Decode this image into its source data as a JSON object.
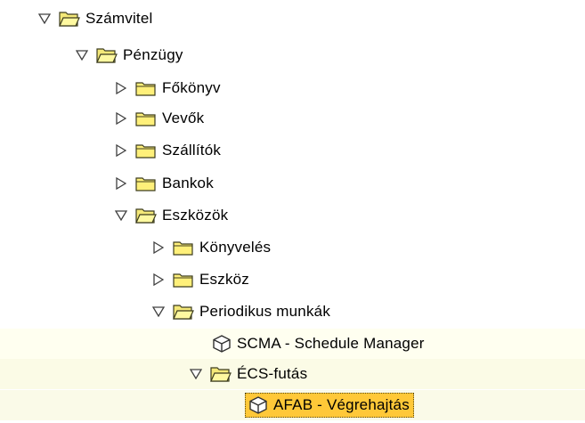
{
  "tree": {
    "nodes": [
      {
        "id": "szamvitel",
        "label": "Számvitel",
        "level": 0,
        "type": "folder",
        "state": "expanded"
      },
      {
        "id": "penzugy",
        "label": "Pénzügy",
        "level": 1,
        "type": "folder",
        "state": "expanded"
      },
      {
        "id": "fokonyv",
        "label": "Főkönyv",
        "level": 2,
        "type": "folder",
        "state": "collapsed"
      },
      {
        "id": "vevok",
        "label": "Vevők",
        "level": 2,
        "type": "folder",
        "state": "collapsed"
      },
      {
        "id": "szallitok",
        "label": "Szállítók",
        "level": 2,
        "type": "folder",
        "state": "collapsed"
      },
      {
        "id": "bankok",
        "label": "Bankok",
        "level": 2,
        "type": "folder",
        "state": "collapsed"
      },
      {
        "id": "eszkozok",
        "label": "Eszközök",
        "level": 2,
        "type": "folder",
        "state": "expanded"
      },
      {
        "id": "konyveles",
        "label": "Könyvelés",
        "level": 3,
        "type": "folder",
        "state": "collapsed"
      },
      {
        "id": "eszkoz",
        "label": "Eszköz",
        "level": 3,
        "type": "folder",
        "state": "collapsed"
      },
      {
        "id": "periodikus",
        "label": "Periodikus munkák",
        "level": 3,
        "type": "folder",
        "state": "expanded"
      },
      {
        "id": "scma",
        "label": "SCMA - Schedule Manager",
        "level": 4,
        "type": "transaction"
      },
      {
        "id": "ecs",
        "label": "ÉCS-futás",
        "level": 4,
        "type": "folder",
        "state": "expanded"
      },
      {
        "id": "afab",
        "label": "AFAB - Végrehajtás",
        "level": 5,
        "type": "transaction",
        "selected": true
      }
    ]
  },
  "colors": {
    "selection": "#ffc838",
    "folder_fill": "#fff07a",
    "folder_stroke": "#4a4a1a"
  },
  "icons": {
    "expanded": "triangle-down-icon",
    "collapsed": "triangle-right-icon",
    "folder_closed": "folder-icon",
    "folder_open": "folder-open-icon",
    "transaction": "transaction-cube-icon"
  }
}
